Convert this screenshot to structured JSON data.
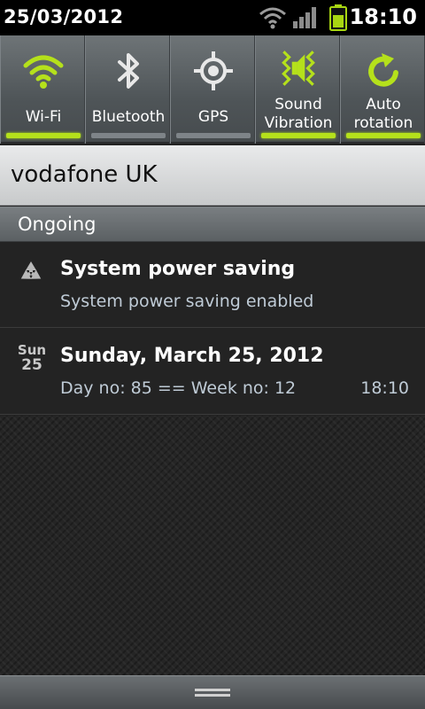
{
  "status_bar": {
    "date": "25/03/2012",
    "time": "18:10",
    "icons": [
      "wifi-icon",
      "signal-icon",
      "battery-icon"
    ],
    "battery_color": "#a8d612"
  },
  "toggles": [
    {
      "label": "Wi-Fi",
      "icon": "wifi-icon",
      "on": true
    },
    {
      "label": "Bluetooth",
      "icon": "bluetooth-icon",
      "on": false
    },
    {
      "label": "GPS",
      "icon": "gps-icon",
      "on": false
    },
    {
      "label_line1": "Sound",
      "label_line2": "Vibration",
      "icon": "sound-vibration-icon",
      "on": true
    },
    {
      "label_line1": "Auto",
      "label_line2": "rotation",
      "icon": "auto-rotation-icon",
      "on": true
    }
  ],
  "accent_color": "#b5e11b",
  "carrier": "vodafone UK",
  "section_header": "Ongoing",
  "notifications": [
    {
      "title": "System power saving",
      "text": "System power saving enabled",
      "icon": "recycle-icon"
    },
    {
      "title": "Sunday, March 25, 2012",
      "text": "Day no: 85 == Week no: 12",
      "time": "18:10",
      "icon": "calendar-icon",
      "icon_day": "Sun",
      "icon_date": "25"
    }
  ]
}
